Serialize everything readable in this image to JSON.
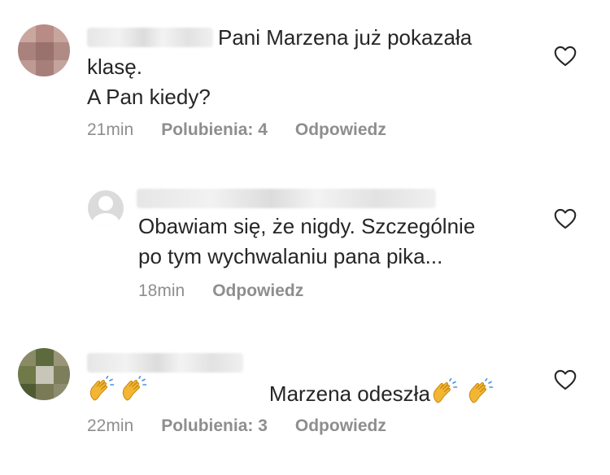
{
  "comments": [
    {
      "text_line1": "Pani Marzena już pokazała",
      "text_rest": "klasę.\nA Pan kiedy?",
      "time": "21min",
      "likes": "Polubienia: 4",
      "reply": "Odpowiedz"
    },
    {
      "text": "Obawiam się, że nigdy. Szczególnie\npo tym wychwalaniu pana pika...",
      "time": "18min",
      "reply": "Odpowiedz"
    },
    {
      "text_line1": "Marzena odeszła",
      "time": "22min",
      "likes": "Polubienia: 3",
      "reply": "Odpowiedz"
    }
  ],
  "icons": {
    "like": "heart-outline-icon",
    "emoji": "clapping-hands-emoji",
    "default_avatar": "default-avatar-icon"
  },
  "colors": {
    "text": "#262626",
    "meta": "#8e8e8e",
    "emoji": "#f2b632"
  }
}
